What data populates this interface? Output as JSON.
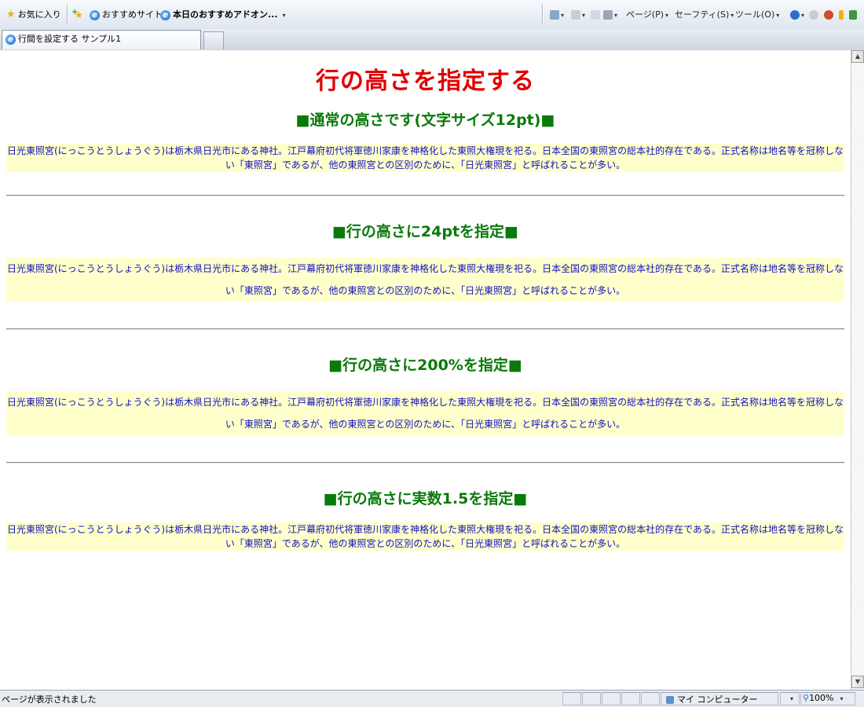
{
  "favorites_bar": {
    "favorites_label": "お気に入り",
    "suggested_sites_label": "おすすめサイト",
    "addons_label": "本日のおすすめアドオン...",
    "page_label": "ページ(P)",
    "safety_label": "セーフティ(S)",
    "tools_label": "ツール(O)"
  },
  "tab": {
    "title": "行間を設定する サンプル1"
  },
  "page": {
    "title": "行の高さを指定する",
    "sections": [
      {
        "heading": "■通常の高さです(文字サイズ12pt)■",
        "paragraph": "日光東照宮(にっこうとうしょうぐう)は栃木県日光市にある神社。江戸幕府初代将軍徳川家康を神格化した東照大権現を祀る。日本全国の東照宮の総本社的存在である。正式名称は地名等を冠称しない「東照宮」であるが、他の東照宮との区別のために、「日光東照宮」と呼ばれることが多い。"
      },
      {
        "heading": "■行の高さに24ptを指定■",
        "paragraph": "日光東照宮(にっこうとうしょうぐう)は栃木県日光市にある神社。江戸幕府初代将軍徳川家康を神格化した東照大権現を祀る。日本全国の東照宮の総本社的存在である。正式名称は地名等を冠称しない「東照宮」であるが、他の東照宮との区別のために、「日光東照宮」と呼ばれることが多い。"
      },
      {
        "heading": "■行の高さに200%を指定■",
        "paragraph": "日光東照宮(にっこうとうしょうぐう)は栃木県日光市にある神社。江戸幕府初代将軍徳川家康を神格化した東照大権現を祀る。日本全国の東照宮の総本社的存在である。正式名称は地名等を冠称しない「東照宮」であるが、他の東照宮との区別のために、「日光東照宮」と呼ばれることが多い。"
      },
      {
        "heading": "■行の高さに実数1.5を指定■",
        "paragraph": "日光東照宮(にっこうとうしょうぐう)は栃木県日光市にある神社。江戸幕府初代将軍徳川家康を神格化した東照大権現を祀る。日本全国の東照宮の総本社的存在である。正式名称は地名等を冠称しない「東照宮」であるが、他の東照宮との区別のために、「日光東照宮」と呼ばれることが多い。"
      }
    ]
  },
  "status_bar": {
    "text": "ページが表示されました",
    "zone": "マイ コンピューター",
    "zoom": "100%"
  },
  "colors": {
    "title": "#e00000",
    "heading": "#0a7a0a",
    "paragraph_text": "#1010c0",
    "paragraph_bg": "#ffffcc"
  }
}
